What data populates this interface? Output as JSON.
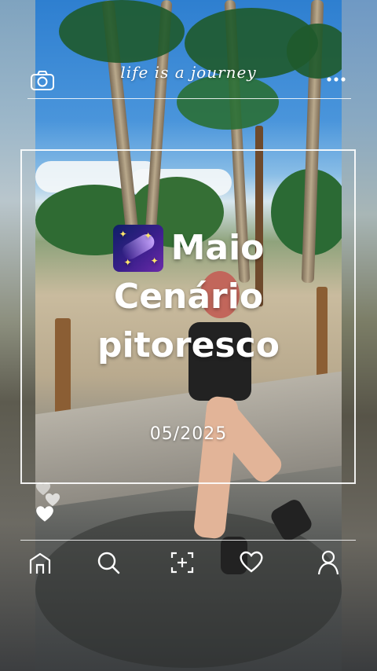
{
  "header": {
    "title": "life is a journey",
    "camera_icon": "camera-icon",
    "more_icon": "more-dots-icon"
  },
  "card": {
    "headline_line1": "Maio",
    "headline_line2": "Cenário",
    "headline_line3": "pitoresco",
    "emoji_icon": "comet-galaxy-emoji",
    "date": "05/2025"
  },
  "side_reactions": {
    "icons": [
      "heart-outline-icon",
      "heart-outline-icon",
      "heart-filled-icon"
    ]
  },
  "bottom_nav": {
    "items": [
      {
        "icon": "home-icon"
      },
      {
        "icon": "search-icon"
      },
      {
        "icon": "add-icon"
      },
      {
        "icon": "heart-icon"
      },
      {
        "icon": "profile-icon"
      }
    ]
  },
  "colors": {
    "overlay_text": "#ffffff",
    "frame": "#ffffff"
  }
}
